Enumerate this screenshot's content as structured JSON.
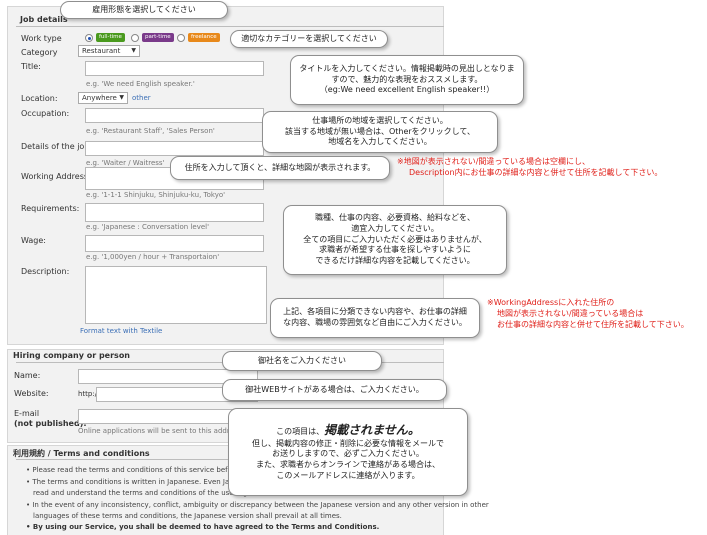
{
  "job_details": {
    "section_title": "Job details",
    "work_type": {
      "label": "Work type",
      "options": [
        {
          "label": "full-time",
          "color": "#4a9a1e",
          "selected": true
        },
        {
          "label": "part-time",
          "color": "#7a3a8a",
          "selected": false
        },
        {
          "label": "freelance",
          "color": "#e8891b",
          "selected": false
        }
      ]
    },
    "category": {
      "label": "Category",
      "value": "Restaurant"
    },
    "title": {
      "label": "Title:",
      "example": "e.g. 'We need English speaker.'"
    },
    "location": {
      "label": "Location:",
      "value": "Anywhere",
      "other_link": "other"
    },
    "occupation": {
      "label": "Occupation:",
      "example": "e.g. 'Restaurant Staff', 'Sales Person'"
    },
    "details": {
      "label": "Details of the job:",
      "example": "e.g. 'Waiter / Waitress'"
    },
    "working_address": {
      "label": "Working Address:",
      "example": "e.g. '1-1-1 Shinjuku, Shinjuku-ku, Tokyo'"
    },
    "requirements": {
      "label": "Requirements:",
      "example": "e.g. 'Japanese : Conversation level'"
    },
    "wage": {
      "label": "Wage:",
      "example": "e.g. '1,000yen / hour + Transportaion'"
    },
    "description": {
      "label": "Description:",
      "format_link": "Format text with Textile"
    }
  },
  "hiring": {
    "section_title": "Hiring company or person",
    "name_label": "Name:",
    "website_label": "Website:",
    "website_prefix": "http://",
    "email_label": "E-mail",
    "email_label2": "(not published):",
    "email_note": "Online applications will be sent to this address"
  },
  "terms": {
    "section_title": "利用規約 / Terms and conditions",
    "items": [
      "Please read the terms and conditions of this service before",
      "The terms and conditions is written in Japanese. Even Japa",
      "read and understand the terms and conditions of the user ag",
      "In the event of any inconsistency, conflict, ambiguity or discrepancy between the Japanese version and any other version in other",
      "languages of these terms and conditions, the Japanese version shall prevail at all times."
    ],
    "bold_item": "By using our Service, you shall be deemed to have agreed to the Terms and Conditions."
  },
  "callouts": {
    "work_type": "雇用形態を選択してください",
    "category": "適切なカテゴリーを選択してください",
    "title": [
      "タイトルを入力してください。情報掲載時の見出しとなりま",
      "すので、魅力的な表現をおススメします。",
      "（eg:We need excellent English speaker!!）"
    ],
    "location": [
      "仕事場所の地域を選択してください。",
      "該当する地域が無い場合は、Otherをクリックして、",
      "地域名を入力してください。"
    ],
    "address": "住所を入力して頂くと、詳細な地図が表示されます。",
    "requirements": [
      "職種、仕事の内容、必要資格、給料などを、",
      "適宜入力してください。",
      "全ての項目にご入力いただく必要はありませんが、",
      "求職者が希望する仕事を探しやすいように",
      "できるだけ詳細な内容を記載してください。"
    ],
    "description": [
      "上記、各項目に分類できない内容や、お仕事の詳細",
      "な内容、職場の雰囲気など自由にご入力ください。"
    ],
    "name": "御社名をご入力ください",
    "website": "御社WEBサイトがある場合は、ご入力ください。",
    "email": {
      "line1_prefix": "この項目は、",
      "line1_emph": "掲載されません。",
      "lines": [
        "但し、掲載内容の修正・削除に必要な情報をメールで",
        "お送りしますので、必ずご入力ください。",
        "また、求職者からオンラインで連絡がある場合は、",
        "このメールアドレスに連絡が入ります。"
      ]
    }
  },
  "red_notes": {
    "address": [
      "※地図が表示されない/間違っている場合は空欄にし、",
      "Description内にお仕事の詳細な内容と併せて住所を記載して下さい。"
    ],
    "description": [
      "※WorkingAddressに入れた住所の",
      "地図が表示されない/間違っている場合は",
      "お仕事の詳細な内容と併せて住所を記載して下さい。"
    ],
    "color": "#e0201a"
  }
}
